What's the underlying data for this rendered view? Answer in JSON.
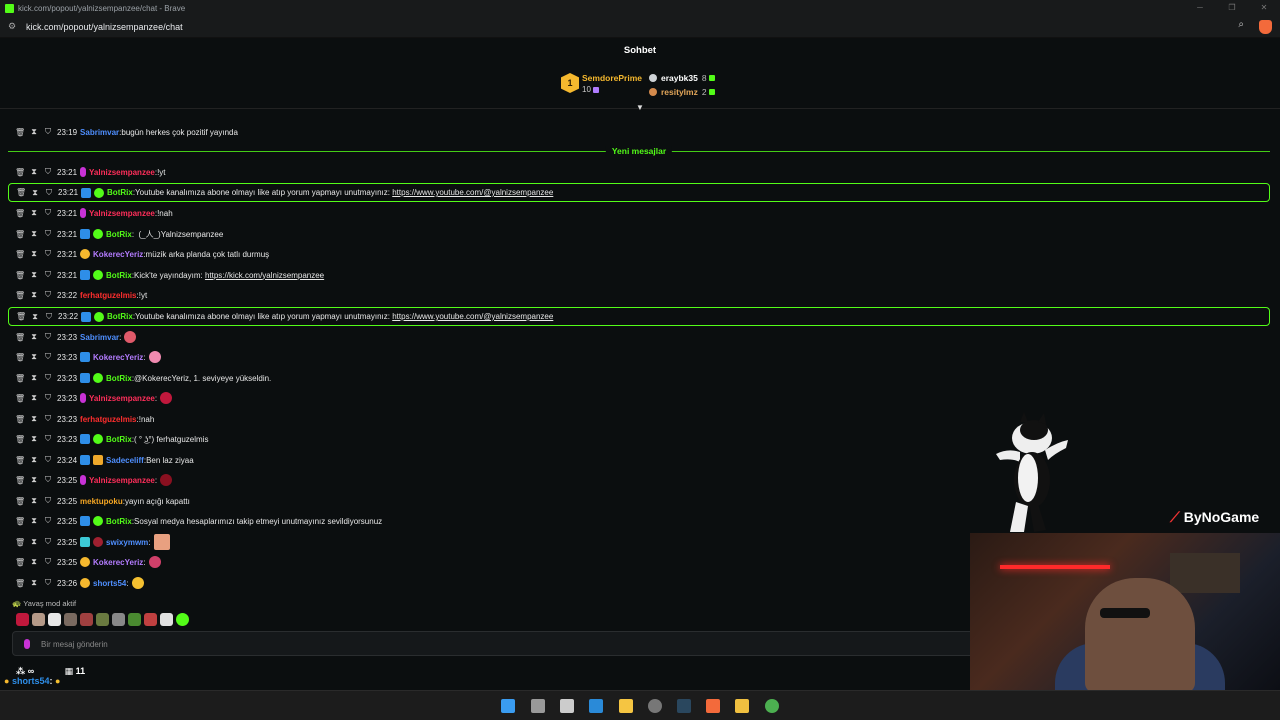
{
  "window": {
    "title": "kick.com/popout/yalnizsempanzee/chat - Brave",
    "url": "kick.com/popout/yalnizsempanzee/chat"
  },
  "header": {
    "title": "Sohbet"
  },
  "leaderboard": {
    "first": {
      "rank": "1",
      "name": "SemdorePrime",
      "count": "10"
    },
    "second": {
      "name": "eraybk35",
      "count": "8"
    },
    "third": {
      "name": "resitylmz",
      "count": "2"
    }
  },
  "new_messages_label": "Yeni mesajlar",
  "messages": [
    {
      "time": "23:19",
      "user": "Sabrimvar",
      "color": "#4f8fff",
      "text": "bugün herkes çok pozitif yayında"
    },
    {
      "time": "23:21",
      "user": "Yalnizsempanzee",
      "color": "#ff2e5a",
      "text": "!yt"
    },
    {
      "time": "23:21",
      "user": "BotRix",
      "color": "#53fc18",
      "text": "Youtube kanalımıza abone olmayı like atıp yorum yapmayı unutmayınız:",
      "link": "https://www.youtube.com/@yalnizsempanzee"
    },
    {
      "time": "23:21",
      "user": "Yalnizsempanzee",
      "color": "#ff2e5a",
      "text": "!nah"
    },
    {
      "time": "23:21",
      "user": "BotRix",
      "color": "#53fc18",
      "text": "(_人_)Yalnizsempanzee"
    },
    {
      "time": "23:21",
      "user": "KokerecYeriz",
      "color": "#b47cff",
      "text": "müzik arka planda çok tatlı durmuş"
    },
    {
      "time": "23:21",
      "user": "BotRix",
      "color": "#53fc18",
      "text": "Kick'te yayındayım:",
      "link": "https://kick.com/yalnizsempanzee"
    },
    {
      "time": "23:22",
      "user": "ferhatguzelmis",
      "color": "#ff2e2e",
      "text": "!yt"
    },
    {
      "time": "23:22",
      "user": "BotRix",
      "color": "#53fc18",
      "text": "Youtube kanalımıza abone olmayı like atıp yorum yapmayı unutmayınız:",
      "link": "https://www.youtube.com/@yalnizsempanzee"
    },
    {
      "time": "23:23",
      "user": "Sabrimvar",
      "color": "#4f8fff",
      "text": ""
    },
    {
      "time": "23:23",
      "user": "KokerecYeriz",
      "color": "#b47cff",
      "text": ""
    },
    {
      "time": "23:23",
      "user": "BotRix",
      "color": "#53fc18",
      "text": "@KokerecYeriz, 1. seviyeye yükseldin."
    },
    {
      "time": "23:23",
      "user": "Yalnizsempanzee",
      "color": "#ff2e5a",
      "text": ""
    },
    {
      "time": "23:23",
      "user": "ferhatguzelmis",
      "color": "#ff2e2e",
      "text": "!nah"
    },
    {
      "time": "23:23",
      "user": "BotRix",
      "color": "#53fc18",
      "text": "( ° ͜ʖ°) ferhatguzelmis"
    },
    {
      "time": "23:24",
      "user": "Sadeceliff",
      "color": "#4f8fff",
      "text": "Ben laz ziyaa"
    },
    {
      "time": "23:25",
      "user": "Yalnizsempanzee",
      "color": "#ff2e5a",
      "text": ""
    },
    {
      "time": "23:25",
      "user": "mektupoku",
      "color": "#f5a623",
      "text": "yayın açığı kapattı"
    },
    {
      "time": "23:25",
      "user": "BotRix",
      "color": "#53fc18",
      "text": "Sosyal medya hesaplarımızı takip etmeyi unutmayınız sevildiyorsunuz"
    },
    {
      "time": "23:25",
      "user": "swixymwm",
      "color": "#4f8fff",
      "text": ""
    },
    {
      "time": "23:25",
      "user": "KokerecYeriz",
      "color": "#b47cff",
      "text": ""
    },
    {
      "time": "23:26",
      "user": "shorts54",
      "color": "#4f8fff",
      "text": ""
    }
  ],
  "slow_mode": "Yavaş mod aktif",
  "input": {
    "placeholder": "Bir mesaj gönderin"
  },
  "footer": {
    "viewers": "∞",
    "count": "11",
    "user": "shorts54"
  },
  "overlay": {
    "brand": "ByNoGame"
  }
}
